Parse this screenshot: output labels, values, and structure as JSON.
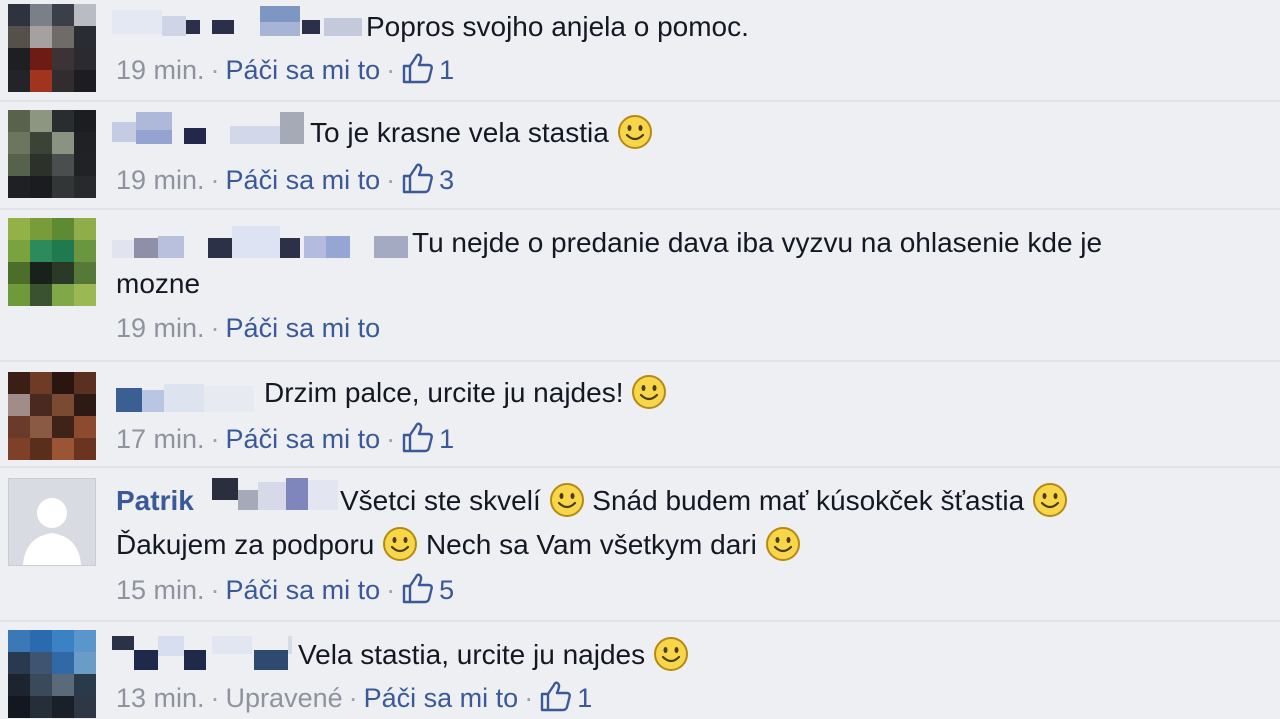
{
  "comments": [
    {
      "author": "",
      "text": "Popros svojho anjela o pomoc.",
      "time": "19 min.",
      "edited": "",
      "like_label": "Páči sa mi to",
      "likes": "1"
    },
    {
      "author": "",
      "text": "To je krasne vela stastia",
      "time": "19 min.",
      "edited": "",
      "like_label": "Páči sa mi to",
      "likes": "3"
    },
    {
      "author": "",
      "text_line1": "Tu nejde o predanie dava iba vyzvu na ohlasenie kde je",
      "text_line2": "mozne",
      "time": "19 min.",
      "edited": "",
      "like_label": "Páči sa mi to",
      "likes": ""
    },
    {
      "author": "",
      "text": "Drzim palce, urcite ju najdes!",
      "time": "17 min.",
      "edited": "",
      "like_label": "Páči sa mi to",
      "likes": "1"
    },
    {
      "author": "Patrik",
      "text_part1": "Všetci ste skvelí",
      "text_part2": "Snád budem mať kúsokček šťastia",
      "text_part3": "Ďakujem za podporu",
      "text_part4": "Nech sa Vam všetkym dari",
      "time": "15 min.",
      "edited": "",
      "like_label": "Páči sa mi to",
      "likes": "5"
    },
    {
      "author": "",
      "text": "Vela stastia, urcite ju najdes",
      "time": "13 min.",
      "edited": "Upravené",
      "like_label": "Páči sa mi to",
      "likes": "1"
    }
  ],
  "separator": "·",
  "icons": {
    "like": "thumbs-up-icon",
    "emoji": "smiley-emoji-icon",
    "avatar_default": "default-avatar-icon"
  },
  "colors": {
    "link": "#3b5998",
    "meta": "#8e939e",
    "text": "#141823",
    "background": "#edeff3"
  }
}
